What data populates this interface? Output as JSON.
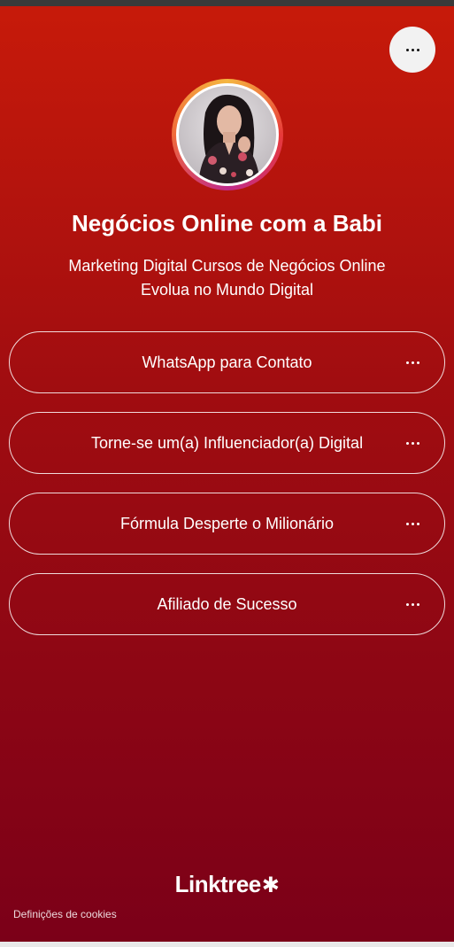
{
  "profile": {
    "title": "Negócios Online com a Babi",
    "bio_line1": "Marketing Digital Cursos de Negócios Online",
    "bio_line2": "Evolua no Mundo Digital"
  },
  "links": [
    {
      "label": "WhatsApp para Contato"
    },
    {
      "label": "Torne-se um(a) Influenciador(a) Digital"
    },
    {
      "label": "Fórmula Desperte o Milionário"
    },
    {
      "label": "Afiliado de Sucesso"
    }
  ],
  "footer": {
    "logo_text": "Linktree",
    "cookies_label": "Definições de cookies"
  },
  "icons": {
    "share": "more-horizontal-icon",
    "link_menu": "more-horizontal-icon",
    "logo_mark": "asterisk-icon"
  },
  "colors": {
    "background_top": "#c71a0a",
    "background_bottom": "#7b0018",
    "text": "#ffffff",
    "share_button_bg": "#f2f2f2"
  }
}
